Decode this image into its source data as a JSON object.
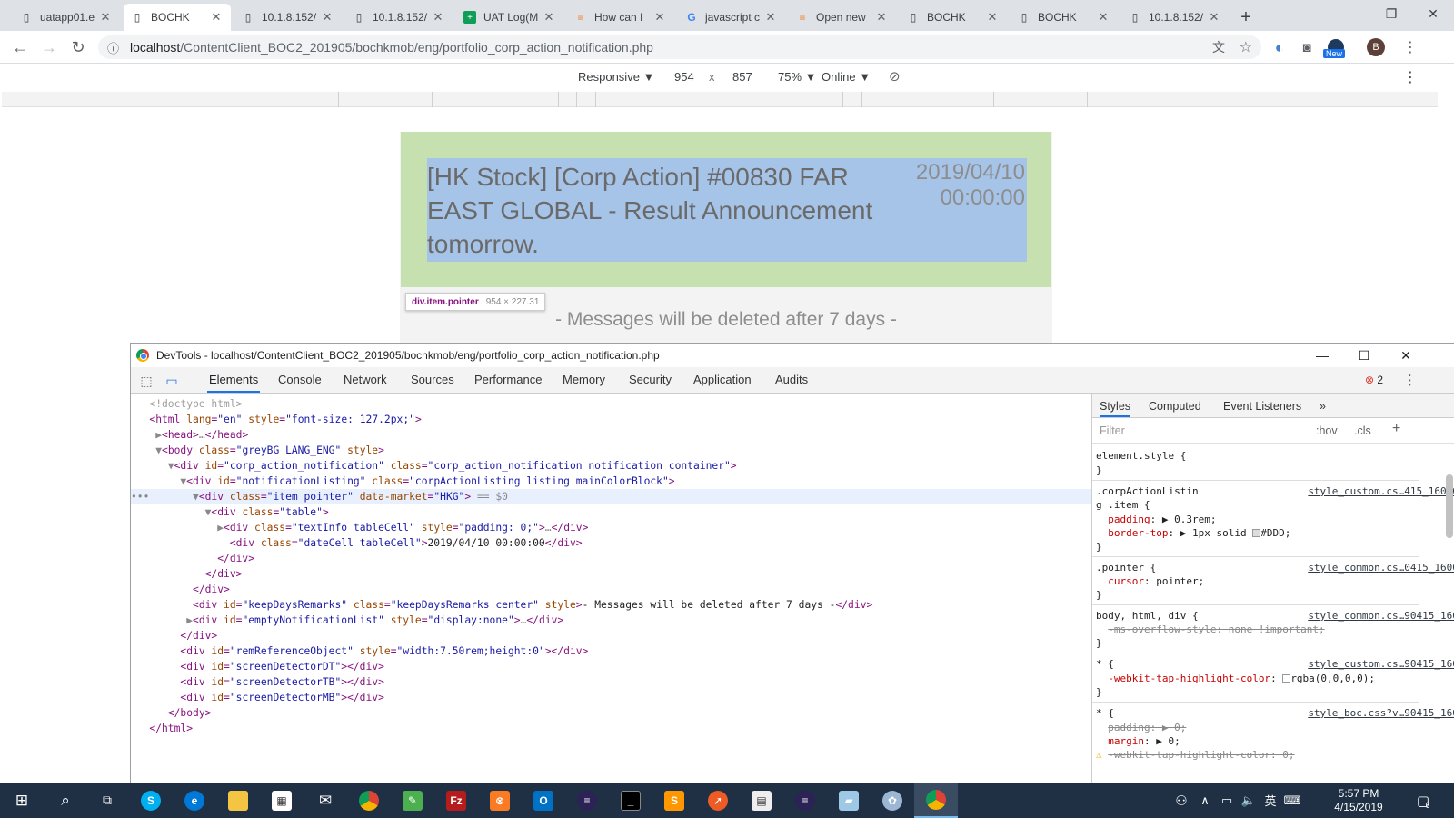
{
  "browser": {
    "tabs": [
      {
        "title": "uatapp01.e",
        "icon": "page-icon",
        "active": false
      },
      {
        "title": "BOCHK",
        "icon": "page-icon",
        "active": true
      },
      {
        "title": "10.1.8.152/",
        "icon": "page-icon",
        "active": false
      },
      {
        "title": "10.1.8.152/",
        "icon": "page-icon",
        "active": false
      },
      {
        "title": "UAT Log(M",
        "icon": "sheets-icon",
        "active": false
      },
      {
        "title": "How can I",
        "icon": "stackoverflow-icon",
        "active": false
      },
      {
        "title": "javascript c",
        "icon": "google-icon",
        "active": false
      },
      {
        "title": "Open new",
        "icon": "stackoverflow-icon",
        "active": false
      },
      {
        "title": "BOCHK",
        "icon": "page-icon",
        "active": false
      },
      {
        "title": "BOCHK",
        "icon": "page-icon",
        "active": false
      },
      {
        "title": "10.1.8.152/",
        "icon": "page-icon",
        "active": false
      }
    ],
    "url_host": "localhost",
    "url_path": "/ContentClient_BOC2_201905/bochkmob/eng/portfolio_corp_action_notification.php",
    "profile_initial": "B",
    "new_badge": "New"
  },
  "device_toolbar": {
    "device": "Responsive ▼",
    "width": "954",
    "times": "x",
    "height": "857",
    "zoom": "75% ▼",
    "network": "Online ▼"
  },
  "page": {
    "notification_title": "[HK Stock] [Corp Action] #00830 FAR EAST GLOBAL - Result Announcement tomorrow.",
    "notification_date": "2019/04/10 00:00:00",
    "inspect_selector": "div.item.pointer",
    "inspect_size": "954 × 227.31",
    "keep_days": "- Messages will be deleted after 7 days -"
  },
  "devtools": {
    "title": "DevTools - localhost/ContentClient_BOC2_201905/bochkmob/eng/portfolio_corp_action_notification.php",
    "tabs": [
      "Elements",
      "Console",
      "Network",
      "Sources",
      "Performance",
      "Memory",
      "Security",
      "Application",
      "Audits"
    ],
    "error_count": "2",
    "styles_tabs": [
      "Styles",
      "Computed",
      "Event Listeners",
      "»"
    ],
    "filter_placeholder": "Filter",
    "hov": ":hov",
    "cls": ".cls",
    "plus": "+"
  },
  "colors": {
    "item_bg": "#c7e0af",
    "selection": "#a6c4e8",
    "active_tab_underline": "#1a73e8",
    "taskbar": "#1f3044"
  },
  "taskbar": {
    "time": "5:57 PM",
    "date": "4/15/2019",
    "lang": "英",
    "notif_count": "6"
  }
}
